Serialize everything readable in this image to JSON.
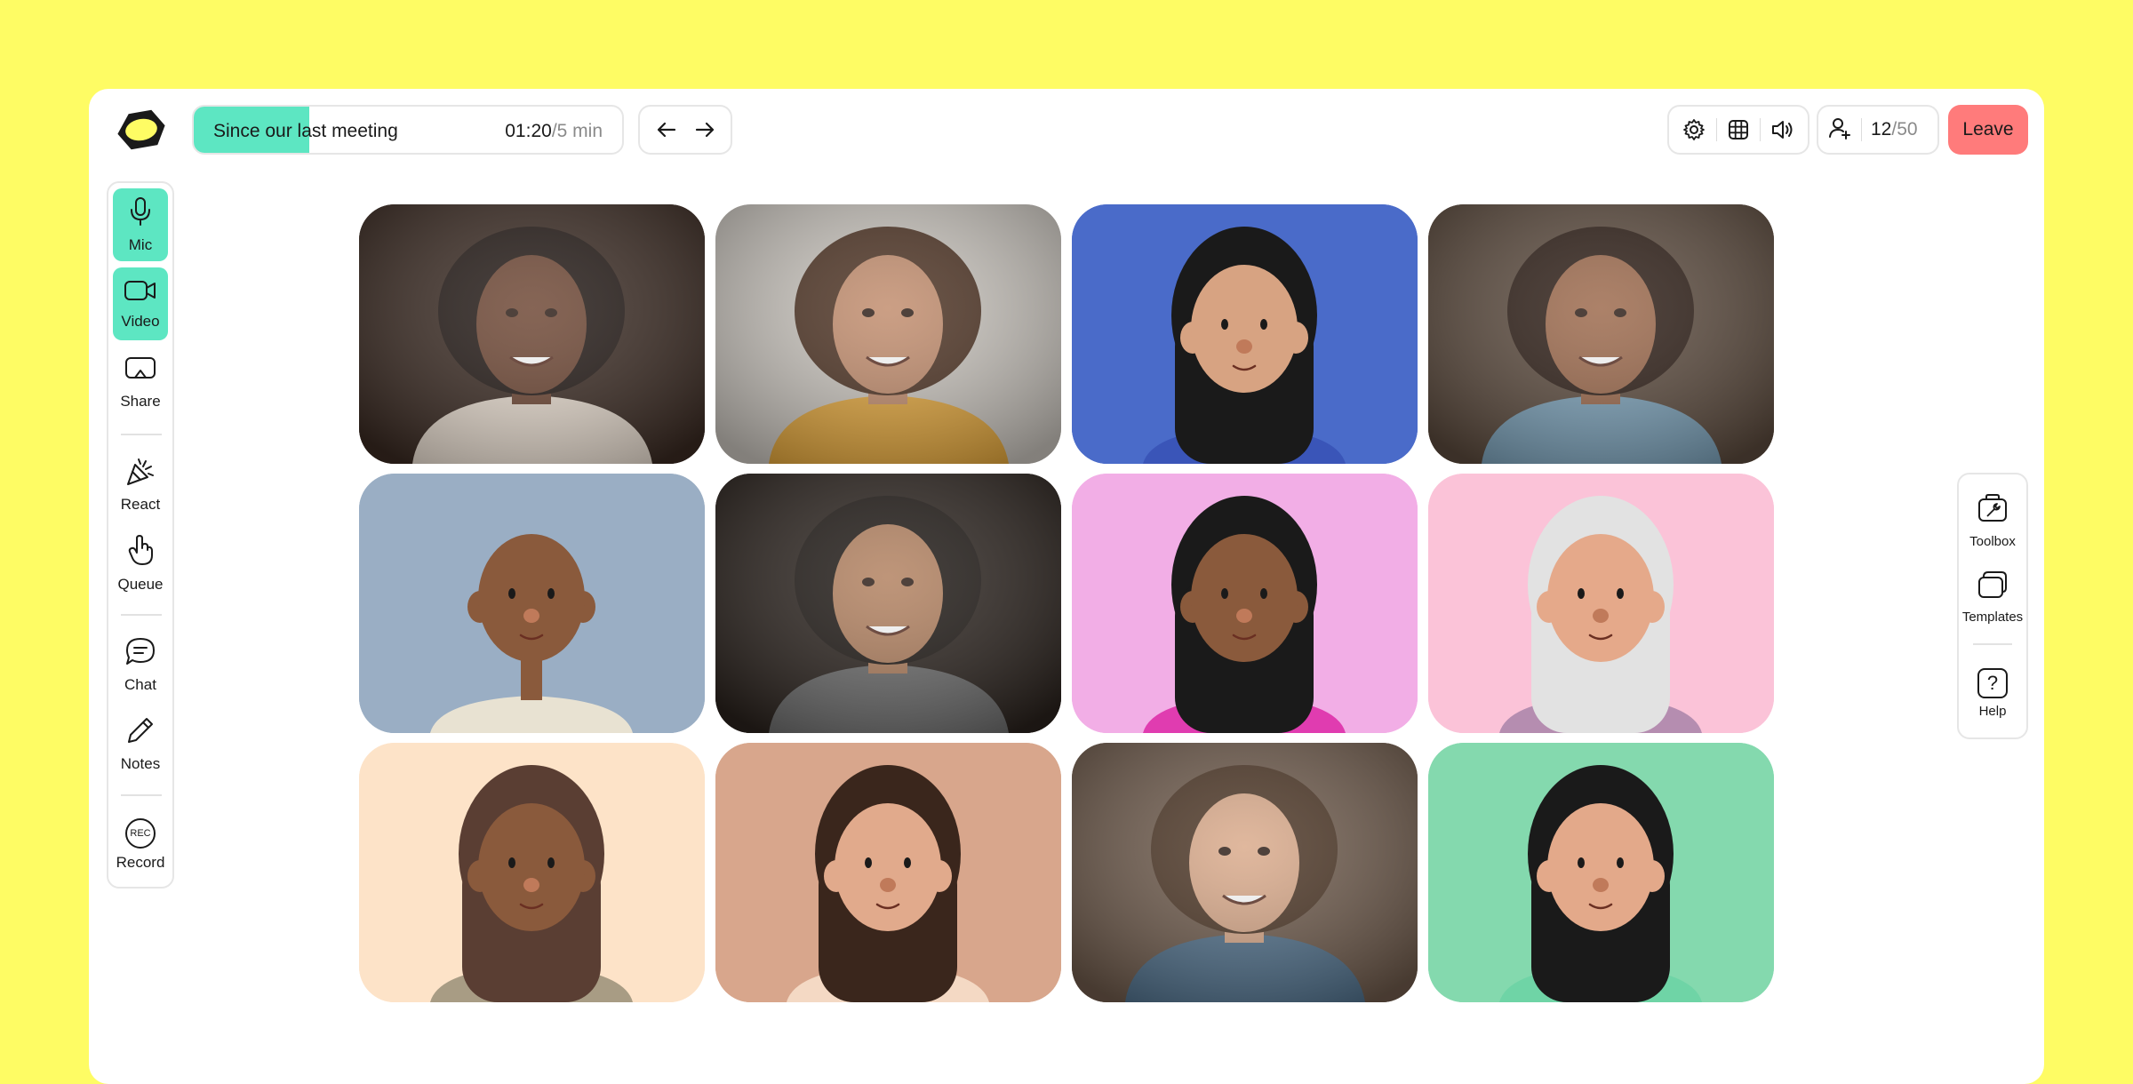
{
  "meeting": {
    "agenda_title": "Since our last meeting",
    "elapsed": "01:20",
    "total": "/5 min",
    "progress_fraction": 0.27
  },
  "participants": {
    "current": "12",
    "max": "/50"
  },
  "header": {
    "leave_label": "Leave"
  },
  "left_rail": {
    "mic": "Mic",
    "video": "Video",
    "share": "Share",
    "react": "React",
    "queue": "Queue",
    "chat": "Chat",
    "notes": "Notes",
    "record": "Record",
    "record_badge": "REC"
  },
  "right_rail": {
    "toolbox": "Toolbox",
    "templates": "Templates",
    "help": "Help",
    "help_glyph": "?"
  },
  "colors": {
    "background": "#fefc64",
    "accent": "#5de6c2",
    "leave": "#ff7b7b"
  },
  "icons": [
    "logo-icon",
    "arrow-left-icon",
    "arrow-right-icon",
    "gear-icon",
    "grid-icon",
    "speaker-icon",
    "add-user-icon",
    "microphone-icon",
    "camera-icon",
    "screen-share-icon",
    "party-popper-icon",
    "raised-hand-icon",
    "chat-bubble-icon",
    "pencil-icon",
    "record-icon",
    "toolbox-icon",
    "templates-icon",
    "help-icon"
  ],
  "video_tiles": [
    {
      "kind": "photo",
      "bg": "#3a2a22",
      "skin": "#6b4330",
      "hair": "#1f1511",
      "top": "#e9ddd0"
    },
    {
      "kind": "photo",
      "bg": "#c9c4bd",
      "skin": "#c08a6a",
      "hair": "#4a2f1f",
      "top": "#e0a43a"
    },
    {
      "kind": "avatar",
      "bg": "#4a6bc9",
      "skin": "#d7a382",
      "hair": "#1a1a1a",
      "top": "#3a55b8"
    },
    {
      "kind": "photo",
      "bg": "#5b4a3d",
      "skin": "#9a6648",
      "hair": "#2a1a12",
      "top": "#7aa0b8"
    },
    {
      "kind": "avatar",
      "bg": "#9aaec4",
      "skin": "#8a5a3c",
      "hair": "none",
      "top": "#e8e2d2"
    },
    {
      "kind": "photo",
      "bg": "#2a221d",
      "skin": "#b07e5c",
      "hair": "#1b1511",
      "top": "#6b6b6b"
    },
    {
      "kind": "avatar",
      "bg": "#f2aee6",
      "skin": "#8a5a3c",
      "hair": "#1a1a1a",
      "top": "#e03cb0"
    },
    {
      "kind": "avatar",
      "bg": "#fbc3d8",
      "skin": "#e5a98a",
      "hair": "#e2e2e2",
      "top": "#b58db0"
    },
    {
      "kind": "avatar",
      "bg": "#fde3c8",
      "skin": "#8a5a3c",
      "hair": "#5a3e33",
      "top": "#a89c84"
    },
    {
      "kind": "avatar",
      "bg": "#d8a68c",
      "skin": "#e1aa8c",
      "hair": "#3a261c",
      "top": "#f4d9c4"
    },
    {
      "kind": "photo",
      "bg": "#6e5a4b",
      "skin": "#d9a888",
      "hair": "#4a3322",
      "top": "#4f6f8a"
    },
    {
      "kind": "avatar",
      "bg": "#84d9ae",
      "skin": "#e3a98a",
      "hair": "#1a1a1a",
      "top": "#6fd4a6"
    }
  ]
}
